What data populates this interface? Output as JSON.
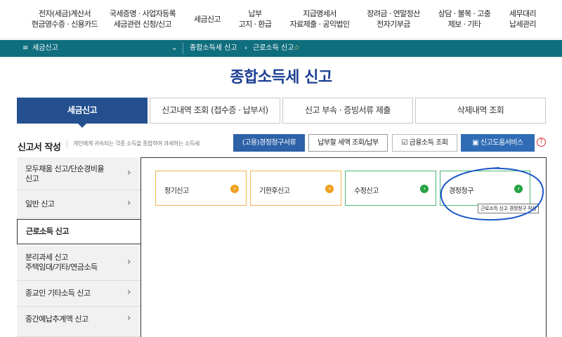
{
  "topnav": [
    {
      "line1": "전자(세금)계산서",
      "line2": "현금영수증 · 신용카드"
    },
    {
      "line1": "국세증명 · 사업자등록",
      "line2": "세금관련 신청/신고"
    },
    {
      "line1": "세금신고",
      "line2": ""
    },
    {
      "line1": "납부",
      "line2": "고지 · 환급"
    },
    {
      "line1": "지급명세서",
      "line2": "자료제출 · 공익법인"
    },
    {
      "line1": "장려금 · 연말정산",
      "line2": "전자기부금"
    },
    {
      "line1": "상담 · 불복 · 고충",
      "line2": "제보 · 기타"
    },
    {
      "line1": "세무대리",
      "line2": "납세관리"
    }
  ],
  "breadcrumb": {
    "menu_icon": "hamburger-icon",
    "level1": "세금신고",
    "level2": "종합소득세 신고",
    "level3": "근로소득 신고",
    "favorite_icon": "star-icon"
  },
  "page_title": "종합소득세 신고",
  "tabs": [
    "세금신고",
    "신고내역 조회 (접수증 · 납부서)",
    "신고 부속 · 증빙서류 제출",
    "삭제내역 조회"
  ],
  "section": {
    "title": "신고서 작성",
    "description": "개인에게 귀속되는 각종 소득을 종합하여 과세하는 소득세"
  },
  "buttons": {
    "refund_docs": "(고용)경정청구서류",
    "tax_inquiry": "납부할 세액 조회/납부",
    "financial_income": "금융소득 조회",
    "help_service": "신고도움서비스",
    "help_mark": "?"
  },
  "left_menu": [
    {
      "label": "모두채움 신고/단순경비율\n신고"
    },
    {
      "label": "일반 신고"
    },
    {
      "label": "근로소득 신고"
    },
    {
      "label": "분리과세 신고\n주택임대/기타/연금소득"
    },
    {
      "label": "종교인 기타소득 신고"
    },
    {
      "label": "중간예납추계액 신고"
    }
  ],
  "cards": [
    {
      "label": "정기신고"
    },
    {
      "label": "기한후신고"
    },
    {
      "label": "수정신고"
    },
    {
      "label": "경정청구"
    }
  ],
  "tooltip": "근로소득 신고 경정청구 작성",
  "colors": {
    "nav_bar": "#0f6e7e",
    "title": "#1b3f92",
    "active_tab": "#24508f",
    "annotation": "#1a56c8",
    "orange": "#f0a020",
    "green": "#25a244"
  }
}
